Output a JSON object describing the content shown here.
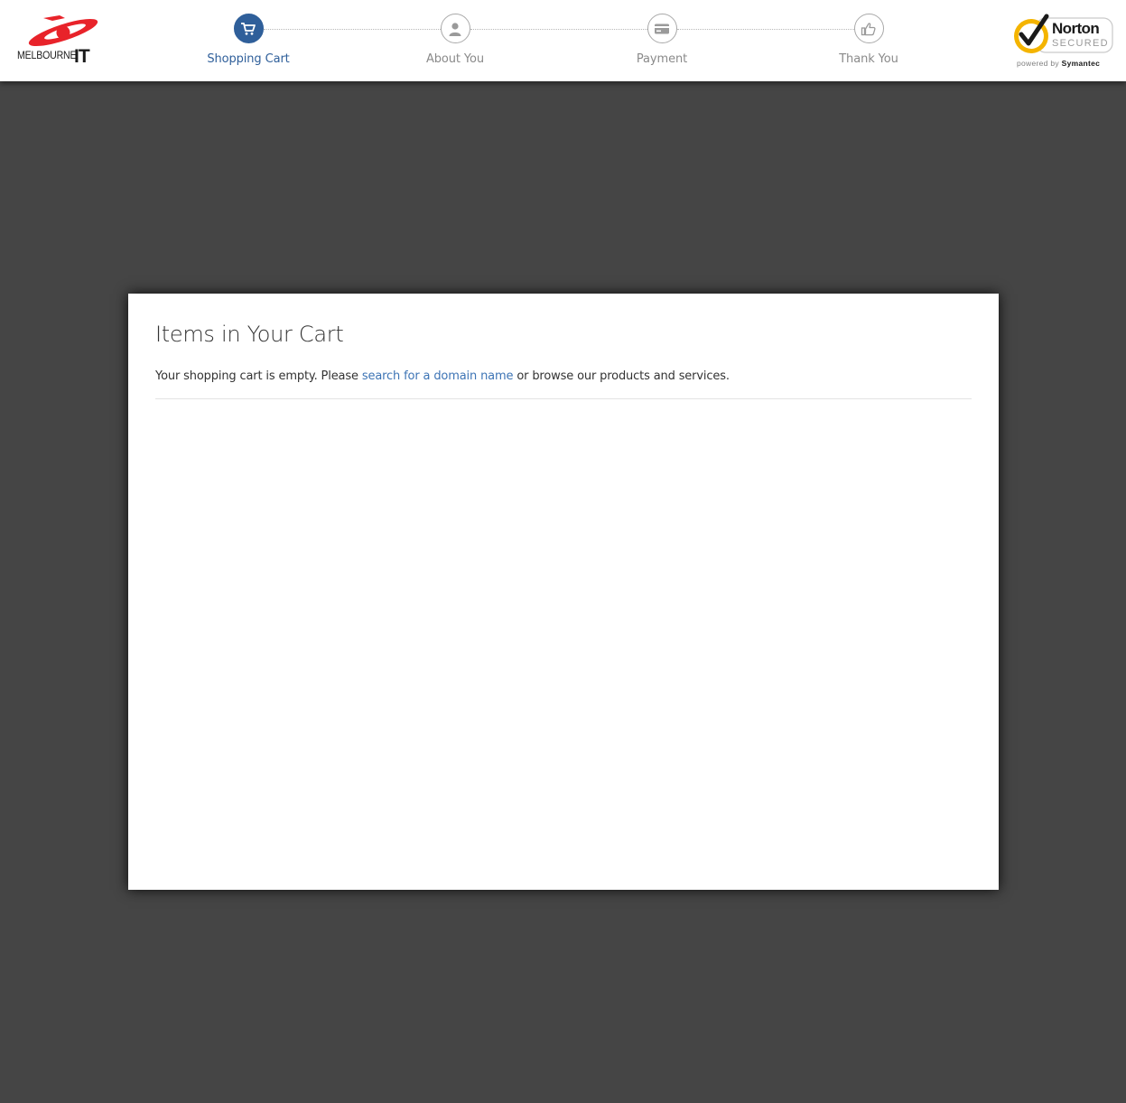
{
  "brand": {
    "logo_text": "MELBOURNE",
    "logo_mark": "IT",
    "accent_red": "#e8232a",
    "accent_blue": "#2f5f9a"
  },
  "steps": [
    {
      "label": "Shopping Cart",
      "icon": "cart-icon",
      "active": true
    },
    {
      "label": "About You",
      "icon": "user-icon",
      "active": false
    },
    {
      "label": "Payment",
      "icon": "credit-card-icon",
      "active": false
    },
    {
      "label": "Thank You",
      "icon": "thumbs-up-icon",
      "active": false
    }
  ],
  "norton": {
    "word": "Norton",
    "secured": "SECURED",
    "powered_by": "powered by",
    "symantec": "Symantec"
  },
  "cart": {
    "title": "Items in Your Cart",
    "message_before": "Your shopping cart is empty. Please ",
    "link_text": "search for a domain name",
    "message_after": " or browse our products and services."
  }
}
